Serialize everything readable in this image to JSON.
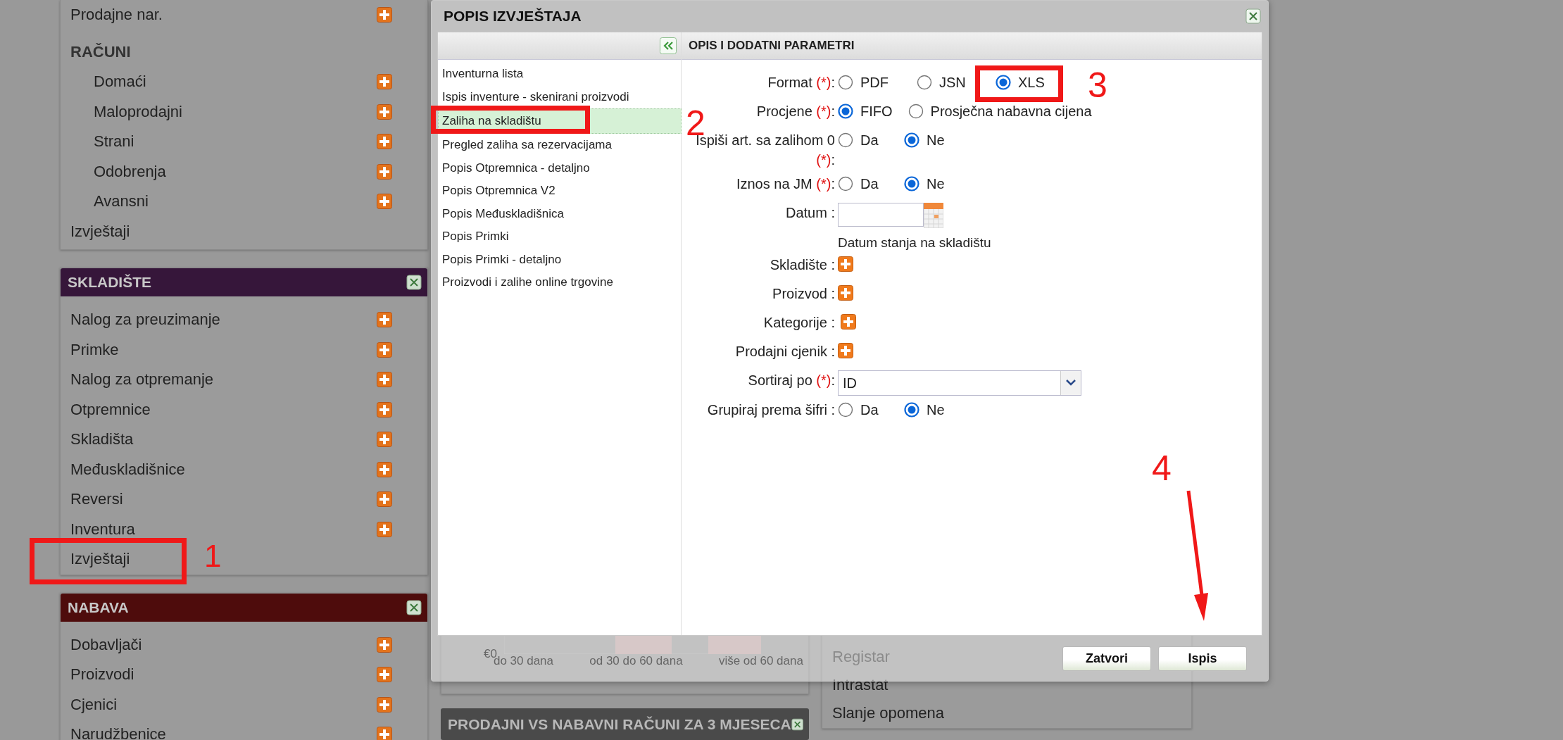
{
  "sidebar": [
    {
      "items": [
        {
          "label": "Prodajne nar.",
          "kind": "link",
          "add": true
        },
        {
          "label": "RAČUNI",
          "kind": "heading",
          "add": false,
          "children": [
            {
              "label": "Domaći",
              "kind": "link",
              "add": true
            },
            {
              "label": "Maloprodajni",
              "kind": "link",
              "add": true
            },
            {
              "label": "Strani",
              "kind": "link",
              "add": true
            },
            {
              "label": "Odobrenja",
              "kind": "link",
              "add": true
            },
            {
              "label": "Avansni",
              "kind": "link",
              "add": true
            }
          ]
        },
        {
          "label": "Izvještaji",
          "kind": "link",
          "add": false
        }
      ]
    },
    {
      "title": "SKLADIŠTE",
      "color": "#36163a",
      "closable": true,
      "items": [
        {
          "label": "Nalog za preuzimanje",
          "kind": "link",
          "add": true
        },
        {
          "label": "Primke",
          "kind": "link",
          "add": true
        },
        {
          "label": "Nalog za otpremanje",
          "kind": "link",
          "add": true
        },
        {
          "label": "Otpremnice",
          "kind": "link",
          "add": true
        },
        {
          "label": "Skladišta",
          "kind": "link",
          "add": true
        },
        {
          "label": "Međuskladišnice",
          "kind": "link",
          "add": true
        },
        {
          "label": "Reversi",
          "kind": "link",
          "add": true
        },
        {
          "label": "Inventura",
          "kind": "link",
          "add": true
        },
        {
          "label": "Izvještaji",
          "kind": "link",
          "add": false
        }
      ]
    },
    {
      "title": "NABAVA",
      "color": "#4e0c0c",
      "closable": true,
      "items": [
        {
          "label": "Dobavljači",
          "kind": "link",
          "add": true
        },
        {
          "label": "Proizvodi",
          "kind": "link",
          "add": true
        },
        {
          "label": "Cjenici",
          "kind": "link",
          "add": true
        },
        {
          "label": "Narudžbenice",
          "kind": "link",
          "add": true
        }
      ]
    }
  ],
  "chart_panel": {
    "axis_label": "€0",
    "categories": [
      "do 30 dana",
      "od 30 do 60 dana",
      "više od 60 dana"
    ]
  },
  "chart_header": {
    "title": "PRODAJNI VS NABAVNI RAČUNI ZA 3 MJESECA",
    "closable": true
  },
  "links_panel": [
    "Registar",
    "Intrastat",
    "Slanje opomena"
  ],
  "dialog": {
    "title": "POPIS IZVJEŠTAJA",
    "closable": true,
    "reports": [
      {
        "label": "Inventurna lista",
        "selected": false
      },
      {
        "label": "Ispis inventure - skenirani proizvodi",
        "selected": false
      },
      {
        "label": "Zaliha na skladištu",
        "selected": true
      },
      {
        "label": "Pregled zaliha sa rezervacijama",
        "selected": false
      },
      {
        "label": "Popis Otpremnica - detaljno",
        "selected": false
      },
      {
        "label": "Popis Otpremnica V2",
        "selected": false
      },
      {
        "label": "Popis Međuskladišnica",
        "selected": false
      },
      {
        "label": "Popis Primki",
        "selected": false
      },
      {
        "label": "Popis Primki - detaljno",
        "selected": false
      },
      {
        "label": "Proizvodi i zalihe online trgovine",
        "selected": false
      }
    ],
    "params_title": "OPIS I DODATNI PARAMETRI",
    "fields": [
      {
        "kind": "radio",
        "label": "Format",
        "required_mark": "(*)",
        "suffix": ":",
        "options": [
          {
            "label": "PDF",
            "selected": false
          },
          {
            "label": "JSN",
            "selected": false
          },
          {
            "label": "XLS",
            "selected": true
          }
        ]
      },
      {
        "kind": "radio",
        "label": "Procjene",
        "required_mark": "(*)",
        "suffix": ":",
        "options": [
          {
            "label": "FIFO",
            "selected": true
          },
          {
            "label": "Prosječna nabavna cijena",
            "selected": false
          }
        ]
      },
      {
        "kind": "radio",
        "label": "Ispiši art. sa zalihom 0",
        "required_mark": "(*)",
        "suffix": ":",
        "options": [
          {
            "label": "Da",
            "selected": false
          },
          {
            "label": "Ne",
            "selected": true
          }
        ]
      },
      {
        "kind": "radio",
        "label": "Iznos na JM",
        "required_mark": "(*)",
        "suffix": ":",
        "options": [
          {
            "label": "Da",
            "selected": false
          },
          {
            "label": "Ne",
            "selected": true
          }
        ]
      },
      {
        "kind": "date",
        "label": "Datum",
        "suffix": ":",
        "hint": "Datum stanja na skladištu"
      },
      {
        "kind": "add",
        "label": "Skladište",
        "suffix": ":"
      },
      {
        "kind": "add",
        "label": "Proizvod",
        "suffix": ":"
      },
      {
        "kind": "add",
        "label": "Kategorije",
        "suffix": ":"
      },
      {
        "kind": "add",
        "label": "Prodajni cjenik",
        "suffix": ":"
      },
      {
        "kind": "select",
        "label": "Sortiraj po",
        "required_mark": "(*)",
        "suffix": ":",
        "value": "ID"
      },
      {
        "kind": "radio",
        "label": "Grupiraj prema šifri",
        "suffix": ":",
        "options": [
          {
            "label": "Da",
            "selected": false
          },
          {
            "label": "Ne",
            "selected": true
          }
        ]
      }
    ],
    "buttons": [
      "Zatvori",
      "Ispis"
    ]
  },
  "annotations": [
    {
      "kind": "box",
      "number": "1"
    },
    {
      "kind": "box",
      "number": "2"
    },
    {
      "kind": "box",
      "number": "3"
    },
    {
      "kind": "arrow",
      "number": "4"
    }
  ]
}
